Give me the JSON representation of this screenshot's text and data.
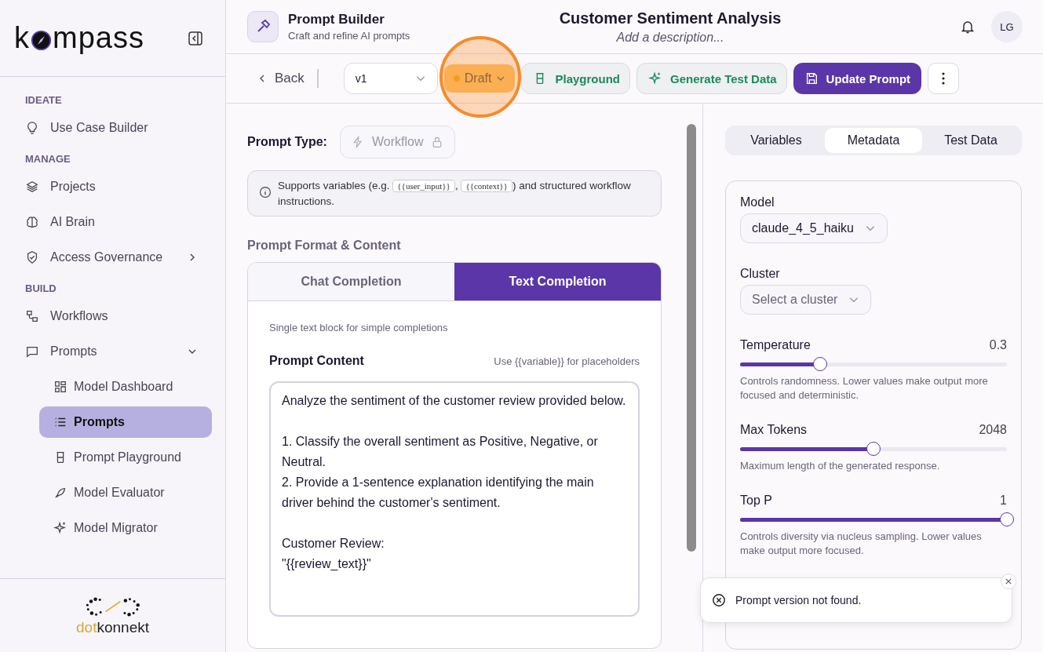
{
  "sidebar": {
    "logo_parts": [
      "k",
      "mpass"
    ],
    "sections": [
      {
        "title": "IDEATE",
        "items": [
          {
            "label": "Use Case Builder",
            "kind": "link",
            "selected": false
          }
        ]
      },
      {
        "title": "MANAGE",
        "items": [
          {
            "label": "Projects",
            "kind": "link",
            "selected": false
          },
          {
            "label": "AI Brain",
            "kind": "link",
            "selected": false
          },
          {
            "label": "Access Governance",
            "kind": "group",
            "expanded": false,
            "selected": false
          }
        ]
      },
      {
        "title": "BUILD",
        "items": [
          {
            "label": "Workflows",
            "kind": "link",
            "selected": false
          },
          {
            "label": "Prompts",
            "kind": "group",
            "expanded": true,
            "selected": false,
            "children": [
              {
                "label": "Model Dashboard",
                "selected": false
              },
              {
                "label": "Prompts",
                "selected": true
              },
              {
                "label": "Prompt Playground",
                "selected": false
              },
              {
                "label": "Model Evaluator",
                "selected": false
              },
              {
                "label": "Model Migrator",
                "selected": false
              }
            ]
          }
        ]
      }
    ],
    "footer_logo": {
      "accent": "dot",
      "rest": "konnekt"
    }
  },
  "header": {
    "app_title": "Prompt Builder",
    "app_subtitle": "Craft and refine AI prompts",
    "title": "Customer Sentiment Analysis",
    "description_placeholder": "Add a description...",
    "avatar": "LG"
  },
  "toolbar": {
    "back": "Back",
    "version": "v1",
    "status": "Draft",
    "highlighted": true,
    "buttons": [
      {
        "label": "Playground",
        "kind": "outline"
      },
      {
        "label": "Generate Test Data",
        "kind": "outline"
      },
      {
        "label": "Update Prompt",
        "kind": "primary"
      }
    ]
  },
  "editor": {
    "type_label": "Prompt Type:",
    "type_value": "Workflow",
    "locked": true,
    "info": [
      {
        "kind": "text",
        "text": "Supports variables (e.g. "
      },
      {
        "kind": "code",
        "text": "{{user_input}}"
      },
      {
        "kind": "text",
        "text": ", "
      },
      {
        "kind": "code",
        "text": "{{context}}"
      },
      {
        "kind": "text",
        "text": ") and structured workflow instructions."
      }
    ],
    "section_title": "Prompt Format & Content",
    "format_tabs": [
      {
        "label": "Chat Completion",
        "selected": false
      },
      {
        "label": "Text Completion",
        "selected": true
      }
    ],
    "format_hint": "Single text block for simple completions",
    "content_label": "Prompt Content",
    "content_hint": "Use {{variable}} for placeholders",
    "content": "Analyze the sentiment of the customer review provided below.\n\n1. Classify the overall sentiment as Positive, Negative, or Neutral.\n2. Provide a 1-sentence explanation identifying the main driver behind the customer's sentiment.\n\nCustomer Review:\n\"{{review_text}}\""
  },
  "panel": {
    "tabs": [
      {
        "label": "Variables",
        "selected": false
      },
      {
        "label": "Metadata",
        "selected": true
      },
      {
        "label": "Test Data",
        "selected": false
      }
    ],
    "fields": [
      {
        "kind": "select",
        "label": "Model",
        "value": "claude_4_5_haiku"
      },
      {
        "kind": "select",
        "label": "Cluster",
        "placeholder": "Select a cluster"
      },
      {
        "kind": "slider",
        "label": "Temperature",
        "reading": "0.3",
        "level": 0.3,
        "help": "Controls randomness. Lower values make output more focused and deterministic."
      },
      {
        "kind": "slider",
        "label": "Max Tokens",
        "reading": "2048",
        "level": 0.5,
        "help": "Maximum length of the generated response."
      },
      {
        "kind": "slider",
        "label": "Top P",
        "reading": "1",
        "level": 1,
        "help": "Controls diversity via nucleus sampling. Lower values make output more focused."
      }
    ]
  },
  "toast": {
    "message": "Prompt version not found."
  }
}
